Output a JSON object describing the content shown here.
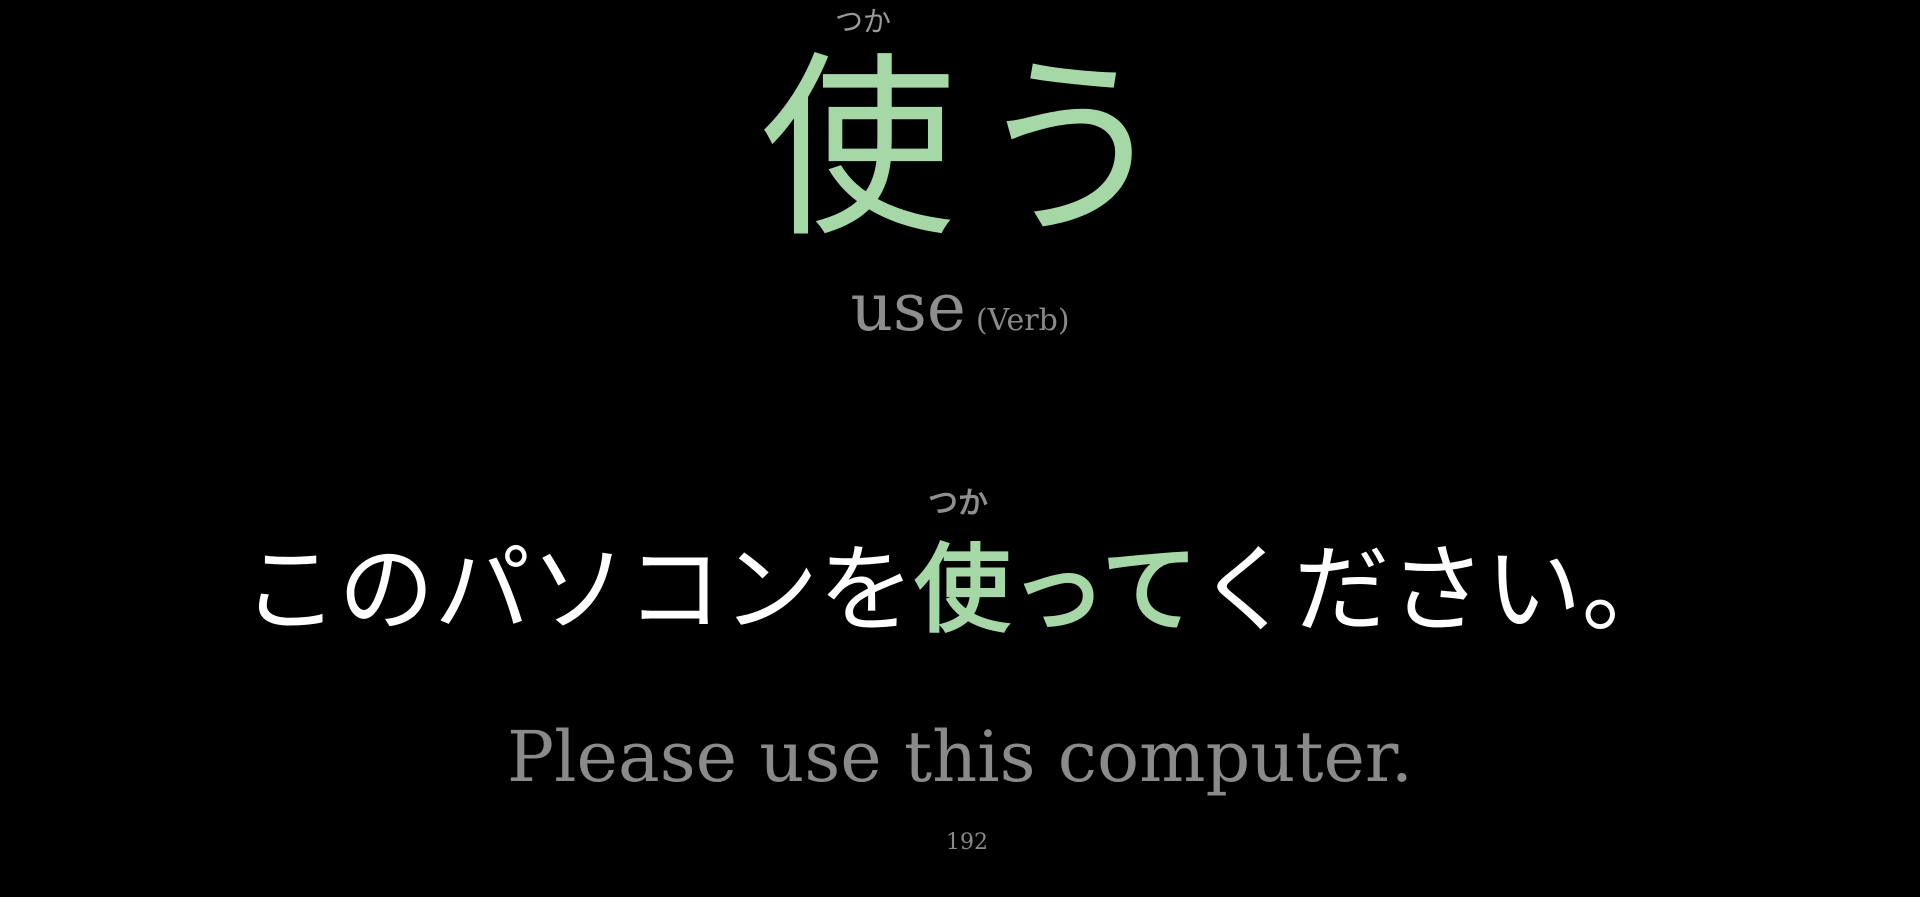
{
  "colors": {
    "background": "#000000",
    "highlight": "#a6d7a6",
    "main_text": "#ffffff",
    "muted_text": "#8e8e8e"
  },
  "word": {
    "reading": "つか",
    "kanji": "使",
    "okurigana": "う",
    "meaning": "use",
    "part_of_speech": "(Verb)"
  },
  "sentence": {
    "reading": "つか",
    "before": "このパソコンを",
    "highlight": "使って",
    "after": "ください。"
  },
  "translation": "Please use this computer.",
  "page_number": "192"
}
